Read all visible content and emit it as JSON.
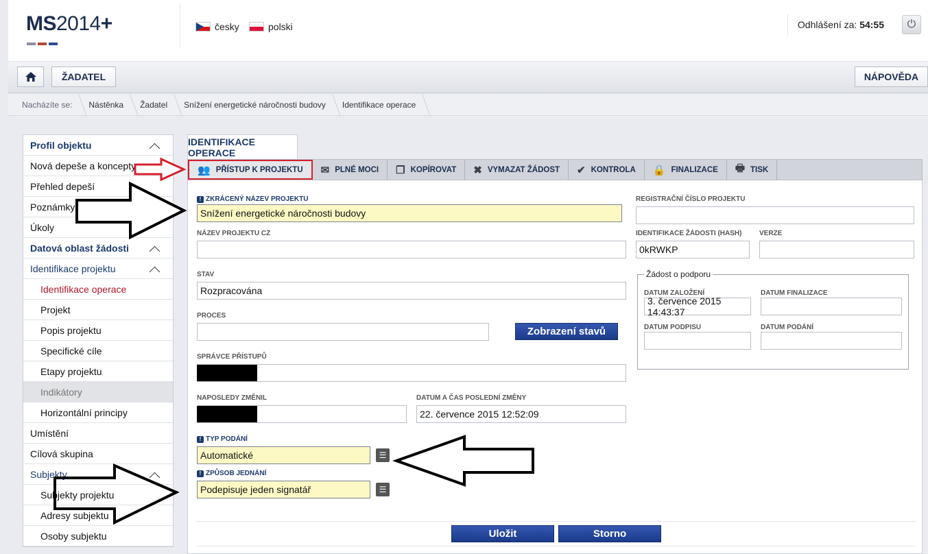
{
  "header": {
    "logo_bold": "MS",
    "logo_thin": "2014",
    "logo_plus": "+",
    "logo_bar_colors": [
      "#8a8f9a",
      "#b5472b",
      "#2a4d8f"
    ],
    "languages": [
      {
        "label": "česky",
        "flag": "cz-flag-icon"
      },
      {
        "label": "polski",
        "flag": "pl-flag-icon"
      }
    ],
    "logout_label": "Odhlášení za:",
    "logout_timer": "54:55",
    "power_icon": "power-icon"
  },
  "toolbar": {
    "home_icon": "home-icon",
    "zadatel_label": "ŽADATEL",
    "napoveda_label": "NÁPOVĚDA"
  },
  "breadcrumb": {
    "prefix": "Nacházíte se:",
    "items": [
      "Nástěnka",
      "Žadatel",
      "Snížení energetické náročnosti budovy",
      "Identifikace operace"
    ]
  },
  "sidebar": {
    "items": [
      {
        "label": "Profil objektu"
      },
      {
        "label": "Nová depeše a koncepty"
      },
      {
        "label": "Přehled depeší"
      },
      {
        "label": "Poznámky"
      },
      {
        "label": "Úkoly"
      },
      {
        "label": "Datová oblast žádosti"
      },
      {
        "label": "Identifikace projektu"
      },
      {
        "label": "Identifikace operace"
      },
      {
        "label": "Projekt"
      },
      {
        "label": "Popis projektu"
      },
      {
        "label": "Specifické cíle"
      },
      {
        "label": "Etapy projektu"
      },
      {
        "label": "Indikátory"
      },
      {
        "label": "Horizontální principy"
      },
      {
        "label": "Umístění"
      },
      {
        "label": "Cílová skupina"
      },
      {
        "label": "Subjekty"
      },
      {
        "label": "Subjekty projektu"
      },
      {
        "label": "Adresy subjektu"
      },
      {
        "label": "Osoby subjektu"
      }
    ]
  },
  "main": {
    "tab_label": "IDENTIFIKACE OPERACE",
    "actions": [
      {
        "label": "PŘÍSTUP K PROJEKTU",
        "icon": "users-icon"
      },
      {
        "label": "PLNÉ MOCI",
        "icon": "envelope-icon"
      },
      {
        "label": "KOPÍROVAT",
        "icon": "copy-icon"
      },
      {
        "label": "VYMAZAT ŽÁDOST",
        "icon": "delete-x-icon"
      },
      {
        "label": "KONTROLA",
        "icon": "check-icon"
      },
      {
        "label": "FINALIZACE",
        "icon": "lock-icon"
      },
      {
        "label": "TISK",
        "icon": "print-icon"
      }
    ],
    "form": {
      "short_name_label": "ZKRÁCENÝ NÁZEV PROJEKTU",
      "short_name_value": "Snížení energetické náročnosti budovy",
      "name_cz_label": "NÁZEV PROJEKTU CZ",
      "name_cz_value": "",
      "stav_label": "STAV",
      "stav_value": "Rozpracována",
      "proces_label": "PROCES",
      "proces_value": "",
      "zobrazeni_button": "Zobrazení stavů",
      "spravce_label": "SPRÁVCE PŘÍSTUPŮ",
      "naposledy_label": "NAPOSLEDY ZMĚNIL",
      "datum_zmeny_label": "DATUM A ČAS POSLEDNÍ ZMĚNY",
      "datum_zmeny_value": "22. července 2015 12:52:09",
      "typ_podani_label": "TYP PODÁNÍ",
      "typ_podani_value": "Automatické",
      "zpusob_label": "ZPŮSOB JEDNÁNÍ",
      "zpusob_value": "Podepisuje jeden signatář",
      "reg_cislo_label": "REGISTRAČNÍ ČÍSLO PROJEKTU",
      "reg_cislo_value": "",
      "hash_label": "IDENTIFIKACE ŽÁDOSTI (HASH)",
      "hash_value": "0kRWKP",
      "verze_label": "VERZE",
      "verze_value": "",
      "fieldset_legend": "Žádost o podporu",
      "datum_zalozeni_label": "DATUM ZALOŽENÍ",
      "datum_zalozeni_value": "3. července 2015 14:43:37",
      "datum_finalizace_label": "DATUM FINALIZACE",
      "datum_finalizace_value": "",
      "datum_podpisu_label": "DATUM PODPISU",
      "datum_podpisu_value": "",
      "datum_podani_label": "DATUM PODÁNÍ",
      "datum_podani_value": "",
      "save_button": "Uložit",
      "storno_button": "Storno"
    }
  },
  "colors": {
    "brand_blue": "#1b3a6b",
    "active_red": "#b0182c",
    "required_yellow": "#fdf9c4",
    "highlight_red": "#d6202e"
  }
}
